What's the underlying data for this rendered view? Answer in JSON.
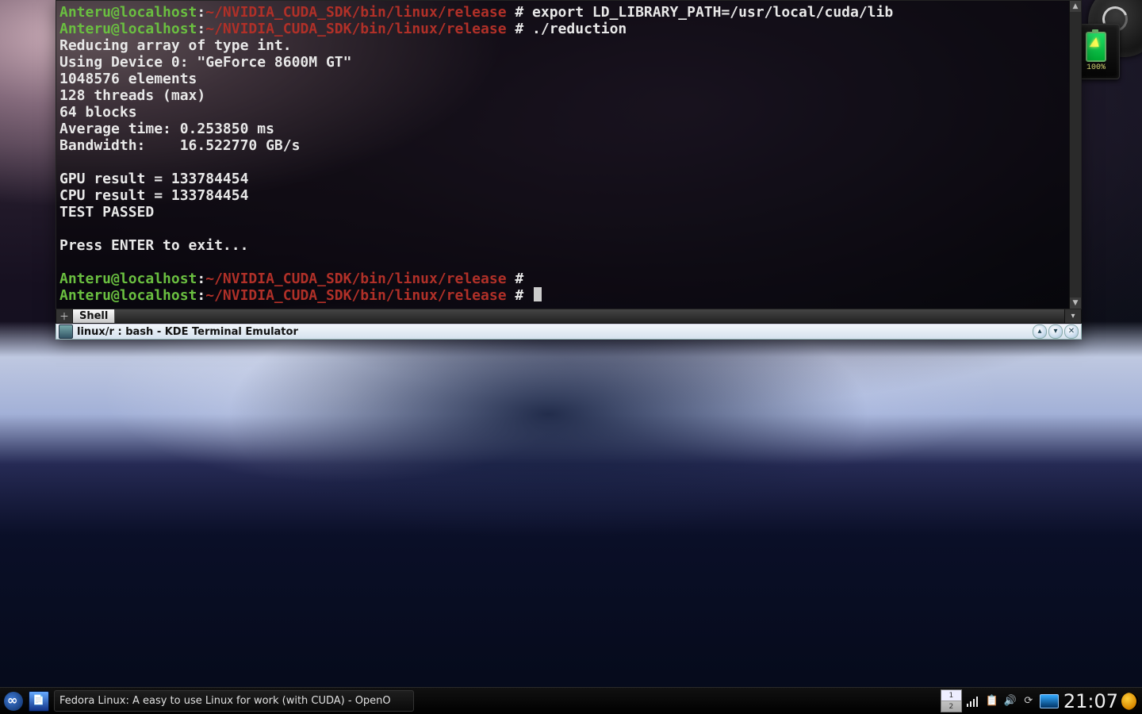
{
  "desktop": {
    "battery_percent": "100%"
  },
  "terminal": {
    "tab_label": "Shell",
    "titlebar": "linux/r : bash - KDE Terminal Emulator",
    "prompt_user": "Anteru@localhost",
    "prompt_path": "~/NVIDIA_CUDA_SDK/bin/linux/release",
    "prompt_sep": ":",
    "prompt_sym": " # ",
    "lines": {
      "cmd1": "export LD_LIBRARY_PATH=/usr/local/cuda/lib",
      "cmd2": "./reduction",
      "o1": "Reducing array of type int.",
      "o2": "Using Device 0: \"GeForce 8600M GT\"",
      "o3": "1048576 elements",
      "o4": "128 threads (max)",
      "o5": "64 blocks",
      "o6": "Average time: 0.253850 ms",
      "o7": "Bandwidth:    16.522770 GB/s",
      "o8": "",
      "o9": "GPU result = 133784454",
      "o10": "CPU result = 133784454",
      "o11": "TEST PASSED",
      "o12": "",
      "o13": "Press ENTER to exit...",
      "o14": ""
    }
  },
  "taskbar": {
    "task_title": "Fedora Linux: A easy to use Linux for work (with CUDA) - OpenO",
    "pager": {
      "ws1": "1",
      "ws2": "2"
    },
    "clock": "21:07"
  }
}
